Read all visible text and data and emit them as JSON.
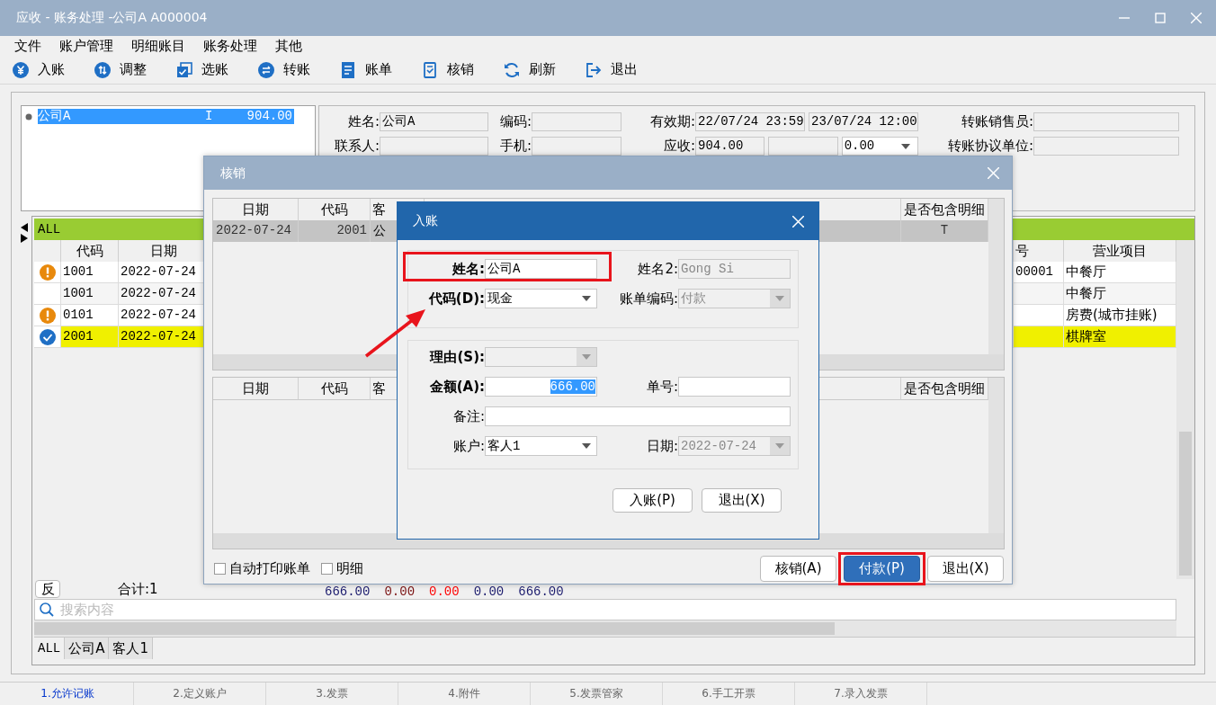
{
  "window": {
    "title": "应收 - 账务处理 -公司A  A000004"
  },
  "menu": [
    "文件",
    "账户管理",
    "明细账目",
    "账务处理",
    "其他"
  ],
  "toolbar": [
    "入账",
    "调整",
    "选账",
    "转账",
    "账单",
    "核销",
    "刷新",
    "退出"
  ],
  "account_list": [
    {
      "name": "公司A",
      "flag": "I",
      "amount": "904.00",
      "selected": true
    }
  ],
  "info_form": {
    "rows": [
      [
        {
          "label": "姓名:",
          "boxes": [
            {
              "kind": "text",
              "value": "公司A"
            }
          ]
        },
        {
          "label": "编码:",
          "boxes": [
            {
              "kind": "text"
            }
          ]
        },
        {
          "label": "有效期:",
          "boxes": [
            {
              "kind": "text",
              "value": "22/07/24 23:59"
            },
            {
              "kind": "text",
              "value": "23/07/24 12:00"
            }
          ]
        },
        {
          "label": "转账销售员:",
          "boxes": [
            {
              "kind": "text"
            }
          ]
        }
      ],
      [
        {
          "label": "联系人:",
          "boxes": [
            {
              "kind": "text"
            }
          ]
        },
        {
          "label": "手机:",
          "boxes": [
            {
              "kind": "text"
            }
          ]
        },
        {
          "label": "应收:",
          "boxes": [
            {
              "kind": "text",
              "value": "904.00"
            },
            {
              "kind": "text"
            },
            {
              "kind": "dropdown",
              "value": "0.00"
            }
          ]
        },
        {
          "label": "转账协议单位:",
          "boxes": [
            {
              "kind": "text"
            }
          ]
        }
      ]
    ]
  },
  "main_grid": {
    "group": "ALL",
    "columns": [
      "代码",
      "日期",
      "号",
      "营业项目"
    ],
    "rows": [
      {
        "kind": "warning",
        "code": "1001",
        "date": "2022-07-24",
        "number": "00001",
        "business": "中餐厅",
        "selected": false
      },
      {
        "kind": "plain",
        "code": "1001",
        "date": "2022-07-24",
        "business": "中餐厅",
        "selected": false
      },
      {
        "kind": "warning",
        "code": "0101",
        "date": "2022-07-24",
        "business": "房费(城市挂账)",
        "selected": false
      },
      {
        "kind": "done",
        "code": "2001",
        "date": "2022-07-24",
        "business": "棋牌室",
        "selected": true
      }
    ],
    "reverse_button": "反",
    "total": "合计:1",
    "sums": [
      {
        "value": "666.00",
        "color": "#1c1c6e"
      },
      {
        "value": "0.00",
        "color": "#7a1010"
      },
      {
        "value": "0.00",
        "color": "#ff0000"
      },
      {
        "value": "0.00",
        "color": "#1c1c6e"
      },
      {
        "value": "666.00",
        "color": "#1c1c6e"
      }
    ],
    "search": {
      "placeholder": "搜索内容"
    },
    "tabs": [
      {
        "label": "ALL",
        "selected": true
      },
      {
        "label": "公司A",
        "selected": false
      },
      {
        "label": "客人1",
        "selected": false
      }
    ]
  },
  "writeoff_dialog": {
    "title": "核销",
    "upper_table": {
      "columns": [
        "日期",
        "代码",
        "客",
        "是否包含明细"
      ],
      "rows": [
        {
          "date": "2022-07-24",
          "code": "2001",
          "guest": "公",
          "detail": "T",
          "selected": true
        }
      ]
    },
    "lower_table": {
      "columns": [
        "日期",
        "代码",
        "客",
        "是否包含明细"
      ]
    },
    "options": [
      {
        "label": "自动打印账单",
        "checked": false
      },
      {
        "label": "明细",
        "checked": false
      }
    ],
    "buttons": [
      {
        "label": "核销(A)",
        "primary": false
      },
      {
        "label": "付款(P)",
        "primary": true,
        "highlighted": true
      },
      {
        "label": "退出(X)",
        "primary": false
      }
    ]
  },
  "entry_dialog": {
    "title": "入账",
    "groups": [
      [
        [
          {
            "label": "姓名:",
            "kind": "text",
            "value": "公司A",
            "emphasized": true,
            "disabled": false,
            "highlighted": true
          },
          {
            "label": "姓名2:",
            "kind": "text",
            "value": "Gong Si",
            "emphasized": false,
            "disabled": true
          }
        ],
        [
          {
            "label": "代码(D):",
            "kind": "dropdown",
            "value": "现金",
            "emphasized": true,
            "disabled": false
          },
          {
            "label": "账单编码:",
            "kind": "dropdown",
            "value": "付款",
            "emphasized": false,
            "disabled": true
          }
        ]
      ],
      [
        [
          {
            "label": "理由(S):",
            "kind": "dropdown",
            "emphasized": true,
            "disabled": true
          }
        ],
        [
          {
            "label": "金额(A):",
            "kind": "text",
            "value": "666.00",
            "emphasized": true,
            "disabled": false,
            "text_selected": true
          },
          {
            "label": "单号:",
            "kind": "text",
            "emphasized": false,
            "disabled": false
          }
        ],
        [
          {
            "label": "备注:",
            "kind": "text",
            "emphasized": false,
            "disabled": false,
            "wide": true
          }
        ],
        [
          {
            "label": "账户:",
            "kind": "dropdown",
            "value": "客人1",
            "emphasized": false,
            "disabled": false
          },
          {
            "label": "日期:",
            "kind": "dropdown",
            "value": "2022-07-24",
            "emphasized": false,
            "disabled": true
          }
        ]
      ]
    ],
    "buttons": [
      "入账(P)",
      "退出(X)"
    ]
  },
  "status_tabs": [
    {
      "label": "1.允许记账",
      "selected": true
    },
    {
      "label": "2.定义账户",
      "selected": false
    },
    {
      "label": "3.发票",
      "selected": false
    },
    {
      "label": "4.附件",
      "selected": false
    },
    {
      "label": "5.发票管家",
      "selected": false
    },
    {
      "label": "6.手工开票",
      "selected": false
    },
    {
      "label": "7.录入发票",
      "selected": false
    }
  ]
}
